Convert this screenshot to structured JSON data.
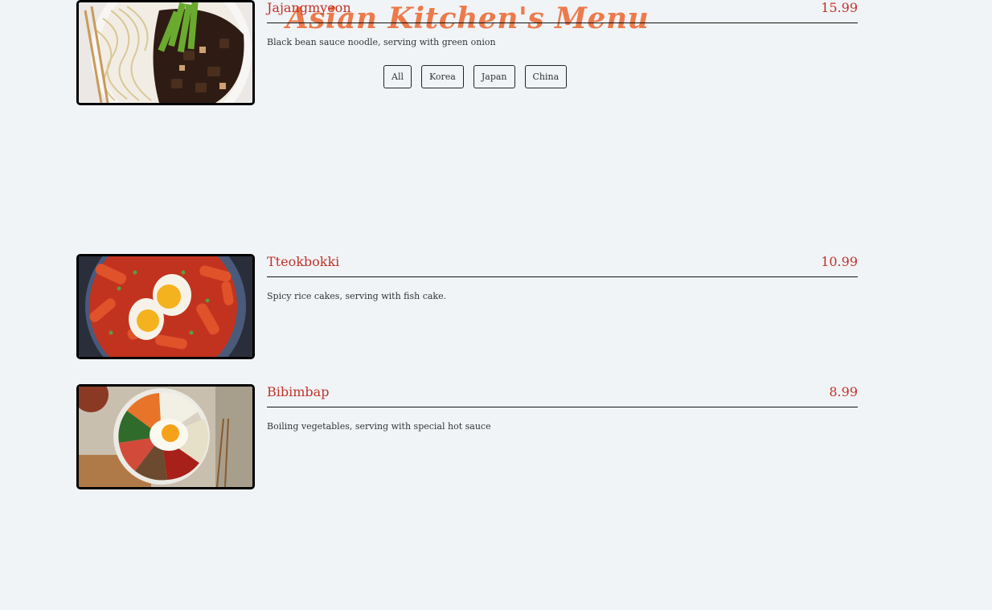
{
  "header": {
    "title": "Asian Kitchen's Menu"
  },
  "filters": [
    "All",
    "Korea",
    "Japan",
    "China"
  ],
  "items": [
    {
      "name": "Tteokbokki",
      "price": "10.99",
      "description": "Spicy rice cakes, serving with fish cake.",
      "image": "tteokbokki-photo"
    },
    {
      "name": "Bibimbap",
      "price": "8.99",
      "description": "Boiling vegetables, serving with special hot sauce",
      "image": "bibimbap-photo"
    },
    {
      "name": "Jajangmyeon",
      "price": "15.99",
      "description": "Black bean sauce noodle, serving with green onion",
      "image": "jajangmyeon-photo"
    }
  ],
  "colors": {
    "title": "#ec7a4b",
    "item_text": "#c0322a",
    "background": "#f1f4f7"
  }
}
